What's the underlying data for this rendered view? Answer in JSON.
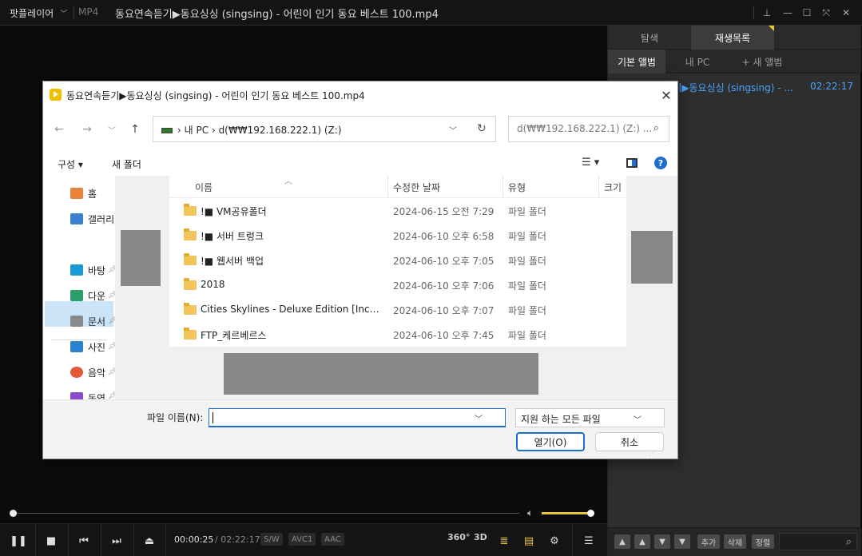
{
  "titlebar": {
    "brand": "팟플레이어",
    "format": "MP4",
    "title": "동요연속듣기▶동요싱싱 (singsing) - 어린이 인기 동요 베스트 100.mp4"
  },
  "right_panel": {
    "tabs": [
      "탐색",
      "재생목록"
    ],
    "subtabs": [
      "기본 앨범",
      "내 PC",
      "+ 새 앨범"
    ],
    "playlist_item": {
      "title": "동요연속듣기▶동요싱싱 (singsing) - ...",
      "duration": "02:22:17"
    },
    "buttons": [
      "▲",
      "▲",
      "▼",
      "▼",
      "추가",
      "삭제",
      "정렬"
    ]
  },
  "controls": {
    "current_time": "00:00:25",
    "total_time": "/ 02:22:17",
    "badges": [
      "S/W",
      "AVC1",
      "AAC"
    ],
    "icon_360": "360°",
    "icon_3d": "3D",
    "seek_fraction": 0.003,
    "volume_fraction": 1.0
  },
  "dialog": {
    "title": "동요연속듣기▶동요싱싱 (singsing) - 어린이 인기 동요 베스트 100.mp4",
    "address": {
      "path": [
        "내 PC",
        "d(₩₩192.168.222.1) (Z:)"
      ]
    },
    "search_placeholder": "d(₩₩192.168.222.1) (Z:) ...",
    "toolbar": {
      "organize": "구성 ▾",
      "new_folder": "새 폴더"
    },
    "nav": [
      {
        "label": "홈",
        "pinned": false
      },
      {
        "label": "갤러리",
        "pinned": false
      },
      {
        "label": "바탕",
        "pinned": true
      },
      {
        "label": "다운",
        "pinned": true
      },
      {
        "label": "문서",
        "pinned": true
      },
      {
        "label": "사진",
        "pinned": true
      },
      {
        "label": "음악",
        "pinned": true
      },
      {
        "label": "동영",
        "pinned": true
      }
    ],
    "columns": [
      "이름",
      "수정한 날짜",
      "유형",
      "크기"
    ],
    "files": [
      {
        "name": "!■ VM공유폴더",
        "modified": "2024-06-15 오전 7:29",
        "type": "파일 폴더"
      },
      {
        "name": "!■ 서버 트렁크",
        "modified": "2024-06-10 오후 6:58",
        "type": "파일 폴더"
      },
      {
        "name": "!■ 웹서버 백업",
        "modified": "2024-06-10 오후 7:05",
        "type": "파일 폴더"
      },
      {
        "name": "2018",
        "modified": "2024-06-10 오후 7:06",
        "type": "파일 폴더"
      },
      {
        "name": "Cities Skylines - Deluxe Edition [Incl DL...",
        "modified": "2024-06-10 오후 7:07",
        "type": "파일 폴더"
      },
      {
        "name": "FTP_케르베르스",
        "modified": "2024-06-10 오후 7:45",
        "type": "파일 폴더"
      }
    ],
    "filename_label": "파일 이름(N):",
    "filename_value": "",
    "filetype": "지원 하는 모든 파일",
    "open_button": "열기(O)",
    "cancel_button": "취소"
  },
  "colors": {
    "accent": "#1a6fd0",
    "player_accent": "#e8c33c",
    "playlist_text": "#4aa3ff"
  }
}
